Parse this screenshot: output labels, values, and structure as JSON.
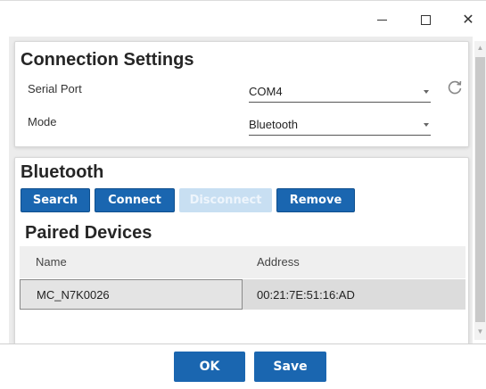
{
  "titlebar": {
    "minimize_symbol": "",
    "maximize_symbol": "",
    "close_symbol": "✕"
  },
  "connection": {
    "title": "Connection Settings",
    "serial_port_label": "Serial Port",
    "serial_port_value": "COM4",
    "mode_label": "Mode",
    "mode_value": "Bluetooth"
  },
  "bluetooth": {
    "title": "Bluetooth",
    "buttons": {
      "search": "Search",
      "connect": "Connect",
      "disconnect": "Disconnect",
      "remove": "Remove"
    },
    "disconnect_enabled": false,
    "paired_title": "Paired Devices",
    "columns": [
      "Name",
      "Address"
    ],
    "devices": [
      {
        "name": "MC_N7K0026",
        "address": "00:21:7E:51:16:AD"
      }
    ]
  },
  "footer": {
    "ok_label": "OK",
    "save_label": "Save"
  },
  "colors": {
    "accent": "#1a66b0",
    "disabled_button": "#c8dff2"
  }
}
